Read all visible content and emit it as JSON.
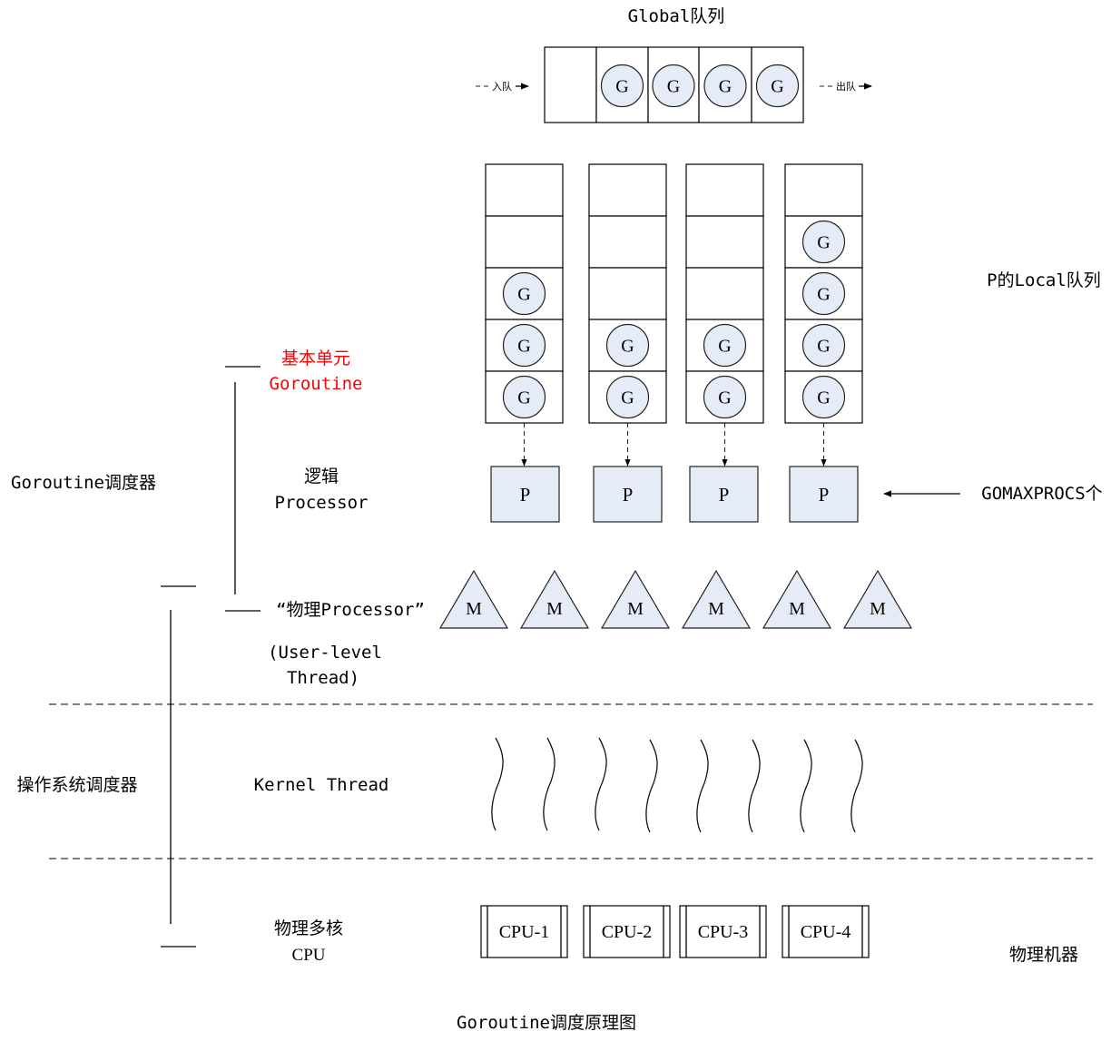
{
  "colors": {
    "node_fill": "#e6ecf7",
    "accent_red": "#ff0000",
    "stroke": "#000000"
  },
  "global_queue": {
    "title": "Global队列",
    "enqueue_label": "入队",
    "dequeue_label": "出队",
    "slots": [
      "",
      "G",
      "G",
      "G",
      "G"
    ]
  },
  "local_queues": {
    "label": "P的Local队列",
    "queues": [
      [
        "",
        "",
        "G",
        "G",
        "G"
      ],
      [
        "",
        "",
        "",
        "G",
        "G"
      ],
      [
        "",
        "",
        "",
        "G",
        "G"
      ],
      [
        "",
        "G",
        "G",
        "G",
        "G"
      ]
    ]
  },
  "processors": {
    "items": [
      "P",
      "P",
      "P",
      "P"
    ],
    "count_label": "GOMAXPROCS个"
  },
  "machines": {
    "items": [
      "M",
      "M",
      "M",
      "M",
      "M",
      "M"
    ]
  },
  "kernel_threads": {
    "count": 8,
    "label": "Kernel Thread"
  },
  "cpus": {
    "items": [
      "CPU-1",
      "CPU-2",
      "CPU-3",
      "CPU-4"
    ]
  },
  "left_labels": {
    "goroutine_scheduler": "Goroutine调度器",
    "os_scheduler": "操作系统调度器",
    "basic_unit_line1": "基本单元",
    "basic_unit_line2": "Goroutine",
    "logical_line1": "逻辑",
    "logical_line2": "Processor",
    "physical_proc_line1": "“物理Processor”",
    "physical_proc_line2": "(User-level",
    "physical_proc_line3": "Thread)",
    "multi_core_line1": "物理多核",
    "multi_core_line2": "CPU"
  },
  "right_labels": {
    "physical_machine": "物理机器"
  },
  "caption": "Goroutine调度原理图"
}
